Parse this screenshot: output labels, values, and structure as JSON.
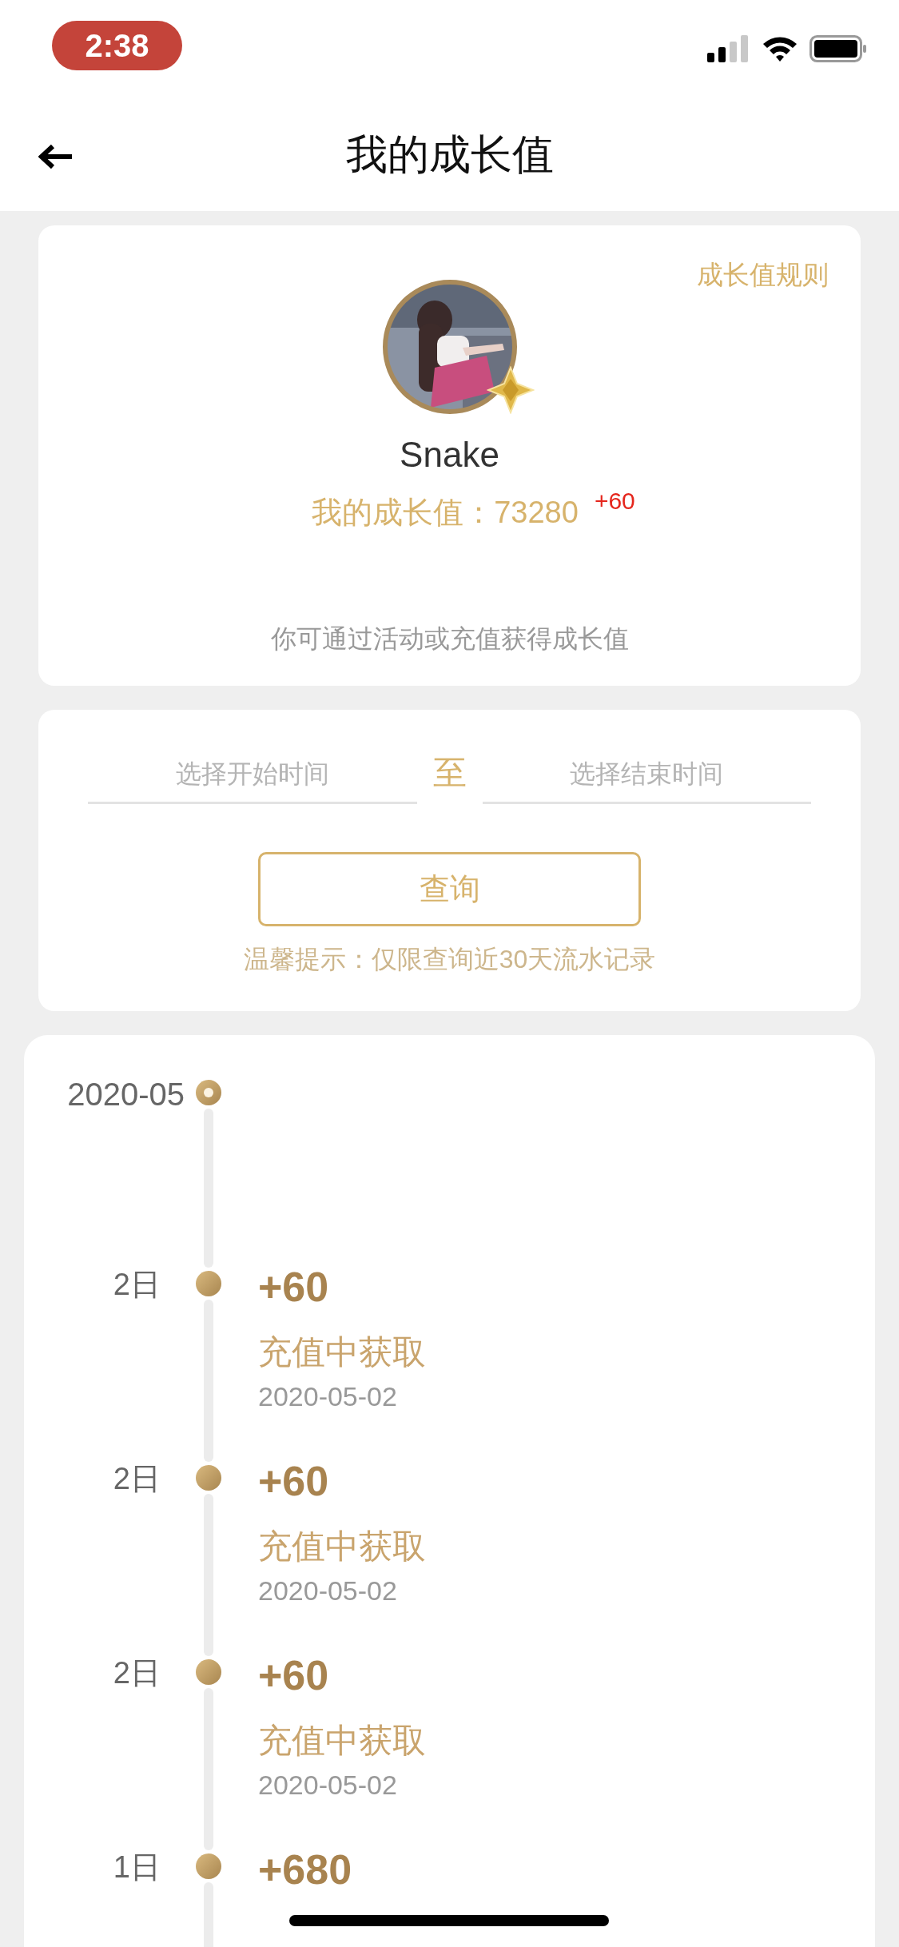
{
  "status_bar": {
    "time": "2:38"
  },
  "header": {
    "title": "我的成长值"
  },
  "profile": {
    "rules_link": "成长值规则",
    "name": "Snake",
    "growth_label": "我的成长值：73280",
    "growth_delta": "+60",
    "hint": "你可通过活动或充值获得成长值"
  },
  "query": {
    "start": {
      "placeholder": "选择开始时间"
    },
    "separator": "至",
    "end": {
      "placeholder": "选择结束时间"
    },
    "button": "查询",
    "tip": "温馨提示：仅限查询近30天流水记录"
  },
  "timeline": [
    {
      "kind": "month",
      "label": "2020-05"
    },
    {
      "kind": "entry",
      "label": "2日",
      "amount": "+60",
      "desc": "充值中获取",
      "date": "2020-05-02"
    },
    {
      "kind": "entry",
      "label": "2日",
      "amount": "+60",
      "desc": "充值中获取",
      "date": "2020-05-02"
    },
    {
      "kind": "entry",
      "label": "2日",
      "amount": "+60",
      "desc": "充值中获取",
      "date": "2020-05-02"
    },
    {
      "kind": "entry",
      "label": "1日",
      "amount": "+680"
    }
  ]
}
